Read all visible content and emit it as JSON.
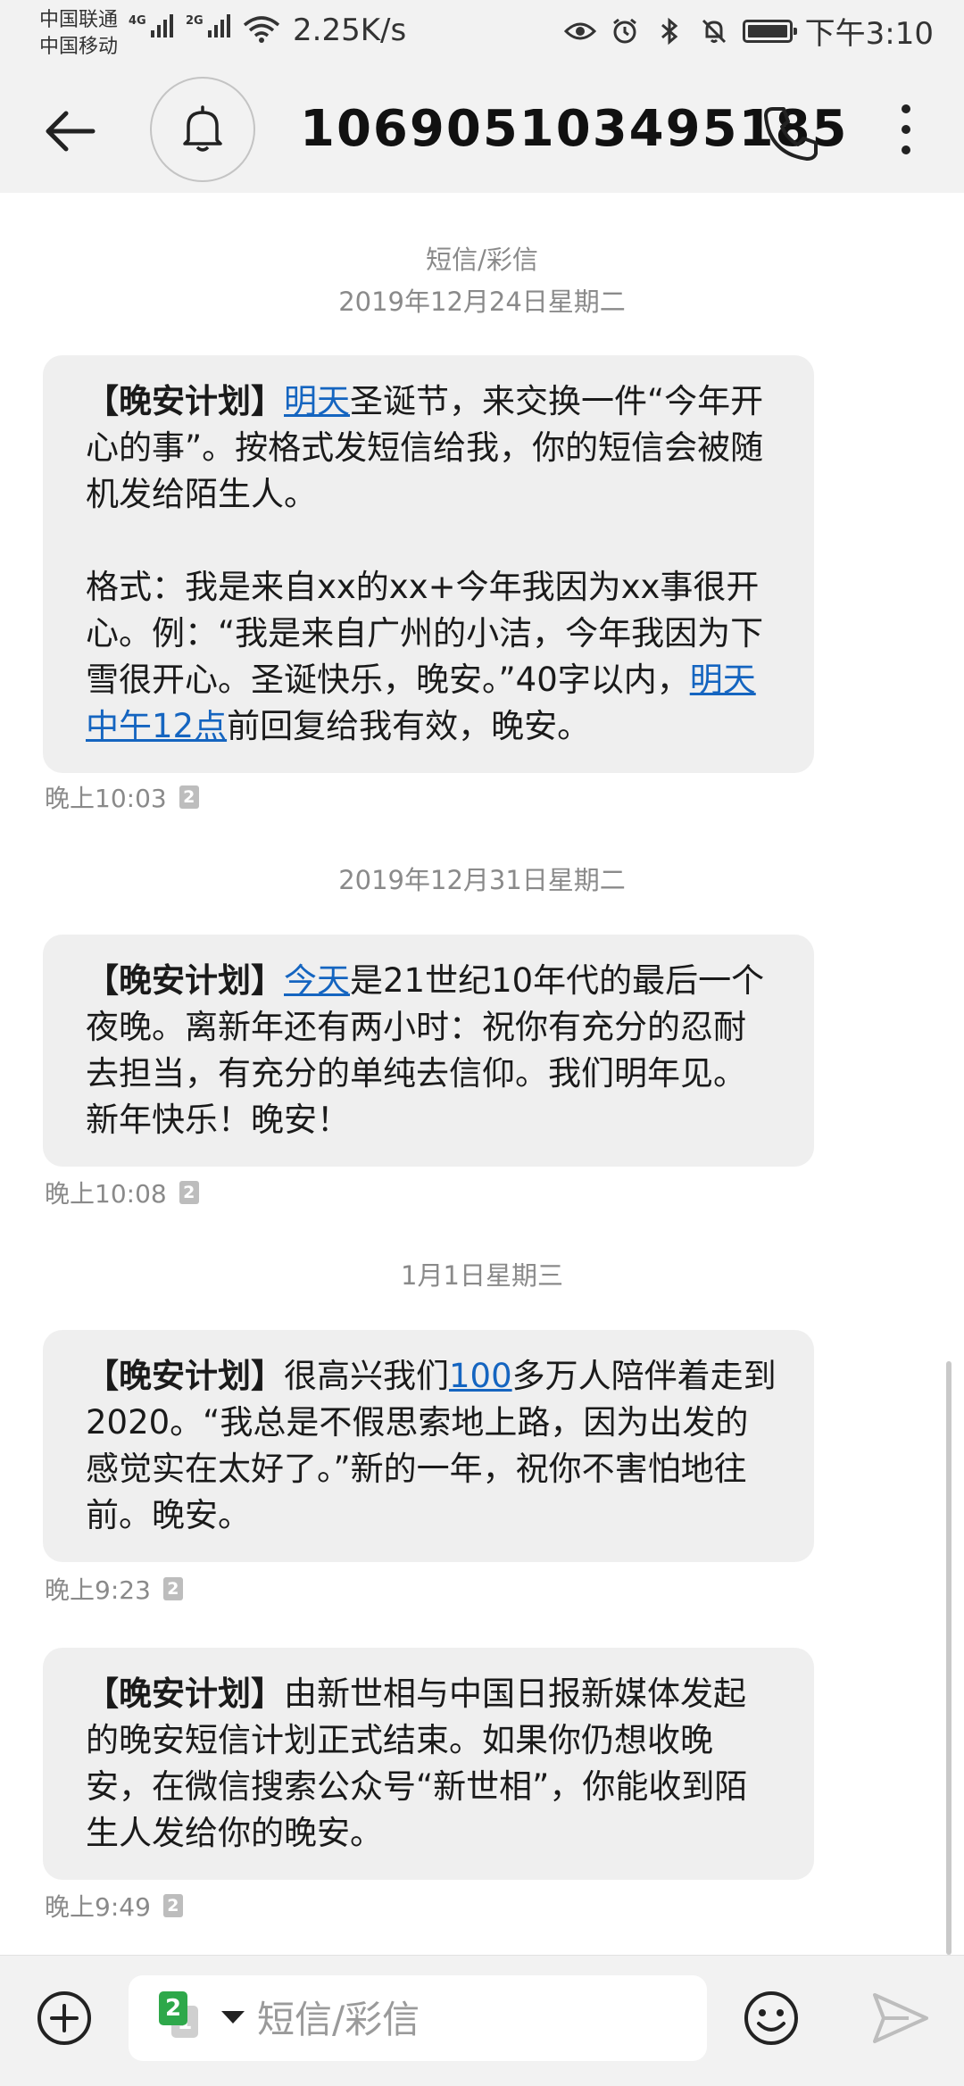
{
  "status_bar": {
    "carrier_1": "中国联通",
    "carrier_2": "中国移动",
    "net_type_1": "4G",
    "net_type_2": "2G",
    "net_speed": "2.25K/s",
    "time": "下午3:10"
  },
  "header": {
    "contact": "106905103495185"
  },
  "conversation": {
    "thread_type": "短信/彩信",
    "dates": [
      "2019年12月24日星期二",
      "2019年12月31日星期二",
      "1月1日星期三"
    ],
    "messages": [
      {
        "parts": [
          {
            "text": "【晚安计划】",
            "style": "bold"
          },
          {
            "text": "明天",
            "style": "link"
          },
          {
            "text": "圣诞节，来交换一件“今年开心的事”。按格式发短信给我，你的短信会被随机发给陌生人。\n\n格式：我是来自xx的xx+今年我因为xx事很开心。例：“我是来自广州的小洁，今年我因为下雪很开心。圣诞快乐，晚安。”40字以内，",
            "style": "plain"
          },
          {
            "text": "明天中午12点",
            "style": "link"
          },
          {
            "text": "前回复给我有效，晚安。",
            "style": "plain"
          }
        ],
        "time": "晚上10:03",
        "sim": "2"
      },
      {
        "parts": [
          {
            "text": "【晚安计划】",
            "style": "bold"
          },
          {
            "text": "今天",
            "style": "link"
          },
          {
            "text": "是21世纪10年代的最后一个夜晚。离新年还有两小时：祝你有充分的忍耐去担当，有充分的单纯去信仰。我们明年见。新年快乐！晚安！",
            "style": "plain"
          }
        ],
        "time": "晚上10:08",
        "sim": "2"
      },
      {
        "parts": [
          {
            "text": "【晚安计划】",
            "style": "bold"
          },
          {
            "text": "很高兴我们",
            "style": "plain"
          },
          {
            "text": "100",
            "style": "link"
          },
          {
            "text": "多万人陪伴着走到2020。“我总是不假思索地上路，因为出发的感觉实在太好了。”新的一年，祝你不害怕地往前。晚安。",
            "style": "plain"
          }
        ],
        "time": "晚上9:23",
        "sim": "2"
      },
      {
        "parts": [
          {
            "text": "【晚安计划】",
            "style": "bold"
          },
          {
            "text": "由新世相与中国日报新媒体发起的晚安短信计划正式结束。如果你仍想收晚安，在微信搜索公众号“新世相”，你能收到陌生人发给你的晚安。",
            "style": "plain"
          }
        ],
        "time": "晚上9:49",
        "sim": "2"
      }
    ]
  },
  "composer": {
    "sim_front": "2",
    "sim_back": "1",
    "placeholder": "短信/彩信"
  },
  "colors": {
    "link": "#1565c0",
    "bubble": "#efefef",
    "bar": "#f2f2f2",
    "sim_active": "#2ea84a"
  }
}
